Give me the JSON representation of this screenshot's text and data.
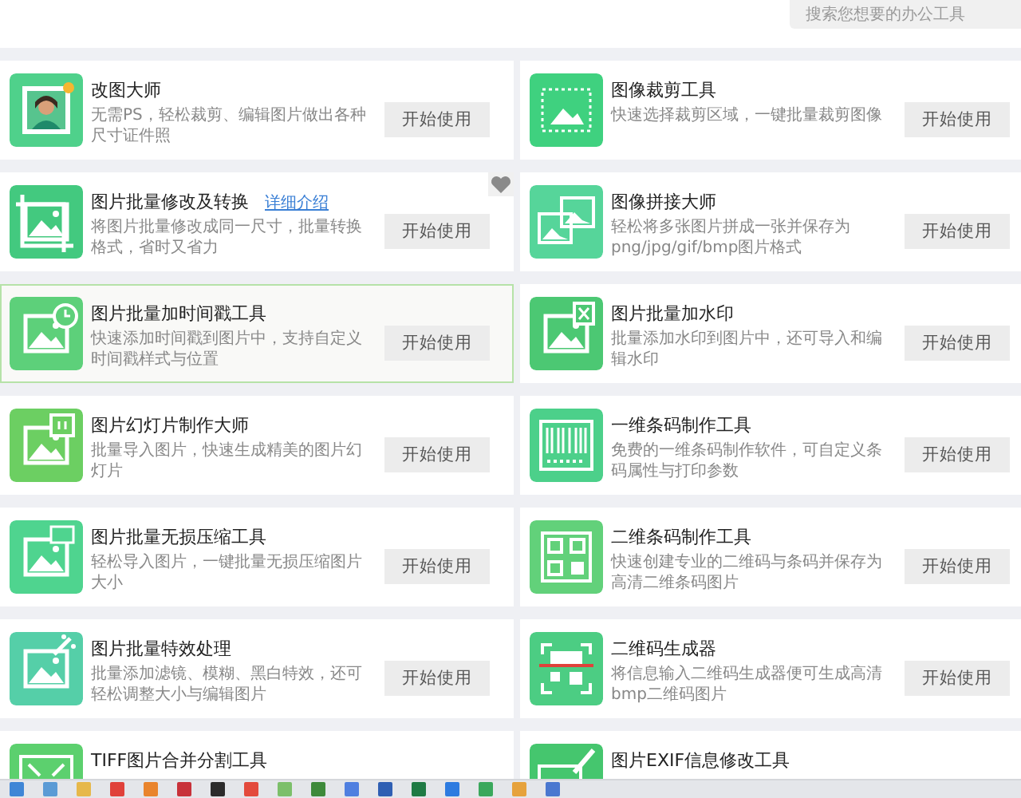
{
  "search": {
    "placeholder": "搜索您想要的办公工具"
  },
  "tools": [
    {
      "kind": "portrait",
      "color": "#4fd18b",
      "title": "改图大师",
      "description": "无需PS，轻松裁剪、编辑图片做出各种尺寸证件照",
      "button": "开始使用",
      "highlighted": false,
      "heart": false
    },
    {
      "kind": "crop",
      "color": "#3fd17f",
      "title": "图像裁剪工具",
      "description": "快速选择裁剪区域，一键批量裁剪图像",
      "button": "开始使用",
      "highlighted": false,
      "heart": false
    },
    {
      "kind": "resize",
      "color": "#43c97f",
      "title": "图片批量修改及转换",
      "link": "详细介绍",
      "description": "将图片批量修改成同一尺寸，批量转换格式，省时又省力",
      "button": "开始使用",
      "highlighted": false,
      "heart": true
    },
    {
      "kind": "collage",
      "color": "#56d59a",
      "title": "图像拼接大师",
      "description": "轻松将多张图片拼成一张并保存为png/jpg/gif/bmp图片格式",
      "button": "开始使用",
      "highlighted": false,
      "heart": false
    },
    {
      "kind": "clock",
      "color": "#5dd07a",
      "title": "图片批量加时间戳工具",
      "description": "快速添加时间戳到图片中，支持自定义时间戳样式与位置",
      "button": "开始使用",
      "highlighted": true,
      "heart": false
    },
    {
      "kind": "watermark",
      "color": "#4cc873",
      "title": "图片批量加水印",
      "description": "批量添加水印到图片中，还可导入和编辑水印",
      "button": "开始使用",
      "highlighted": false,
      "heart": false
    },
    {
      "kind": "slides",
      "color": "#6ccf62",
      "title": "图片幻灯片制作大师",
      "description": "批量导入图片，快速生成精美的图片幻灯片",
      "button": "开始使用",
      "highlighted": false,
      "heart": false
    },
    {
      "kind": "barcode",
      "color": "#4cd08a",
      "title": "一维条码制作工具",
      "description": "免费的一维条码制作软件，可自定义条码属性与打印参数",
      "button": "开始使用",
      "highlighted": false,
      "heart": false
    },
    {
      "kind": "zip",
      "color": "#4fd48f",
      "title": "图片批量无损压缩工具",
      "description": "轻松导入图片，一键批量无损压缩图片大小",
      "button": "开始使用",
      "highlighted": false,
      "heart": false
    },
    {
      "kind": "qrcode",
      "color": "#62d17a",
      "title": "二维条码制作工具",
      "description": "快速创建专业的二维码与条码并保存为高清二维条码图片",
      "button": "开始使用",
      "highlighted": false,
      "heart": false
    },
    {
      "kind": "effects",
      "color": "#55cfa8",
      "title": "图片批量特效处理",
      "description": "批量添加滤镜、模糊、黑白特效，还可轻松调整大小与编辑图片",
      "button": "开始使用",
      "highlighted": false,
      "heart": false
    },
    {
      "kind": "qrscan",
      "color": "#4ccd83",
      "title": "二维码生成器",
      "description": "将信息输入二维码生成器便可生成高清bmp二维码图片",
      "button": "开始使用",
      "highlighted": false,
      "heart": false
    },
    {
      "kind": "tiff",
      "color": "#5cd06e",
      "title": "TIFF图片合并分割工具",
      "highlighted": false,
      "heart": false
    },
    {
      "kind": "exif",
      "color": "#45c66e",
      "title": "图片EXIF信息修改工具",
      "highlighted": false,
      "heart": false
    }
  ],
  "taskbar": {
    "apps": [
      {
        "color": "#3f86d6"
      },
      {
        "color": "#5b9bd5"
      },
      {
        "color": "#e6b84a"
      },
      {
        "color": "#e0413a"
      },
      {
        "color": "#e9842c"
      },
      {
        "color": "#c8323a"
      },
      {
        "color": "#2b2b2b"
      },
      {
        "color": "#e34a3c"
      },
      {
        "color": "#7cbf6a"
      },
      {
        "color": "#3e8a3a"
      },
      {
        "color": "#4f7fe0"
      },
      {
        "color": "#2f5fb3"
      },
      {
        "color": "#1f7a44"
      },
      {
        "color": "#2d7be0"
      },
      {
        "color": "#3aa85c"
      },
      {
        "color": "#e6a23c"
      },
      {
        "color": "#4a78d0"
      }
    ]
  }
}
